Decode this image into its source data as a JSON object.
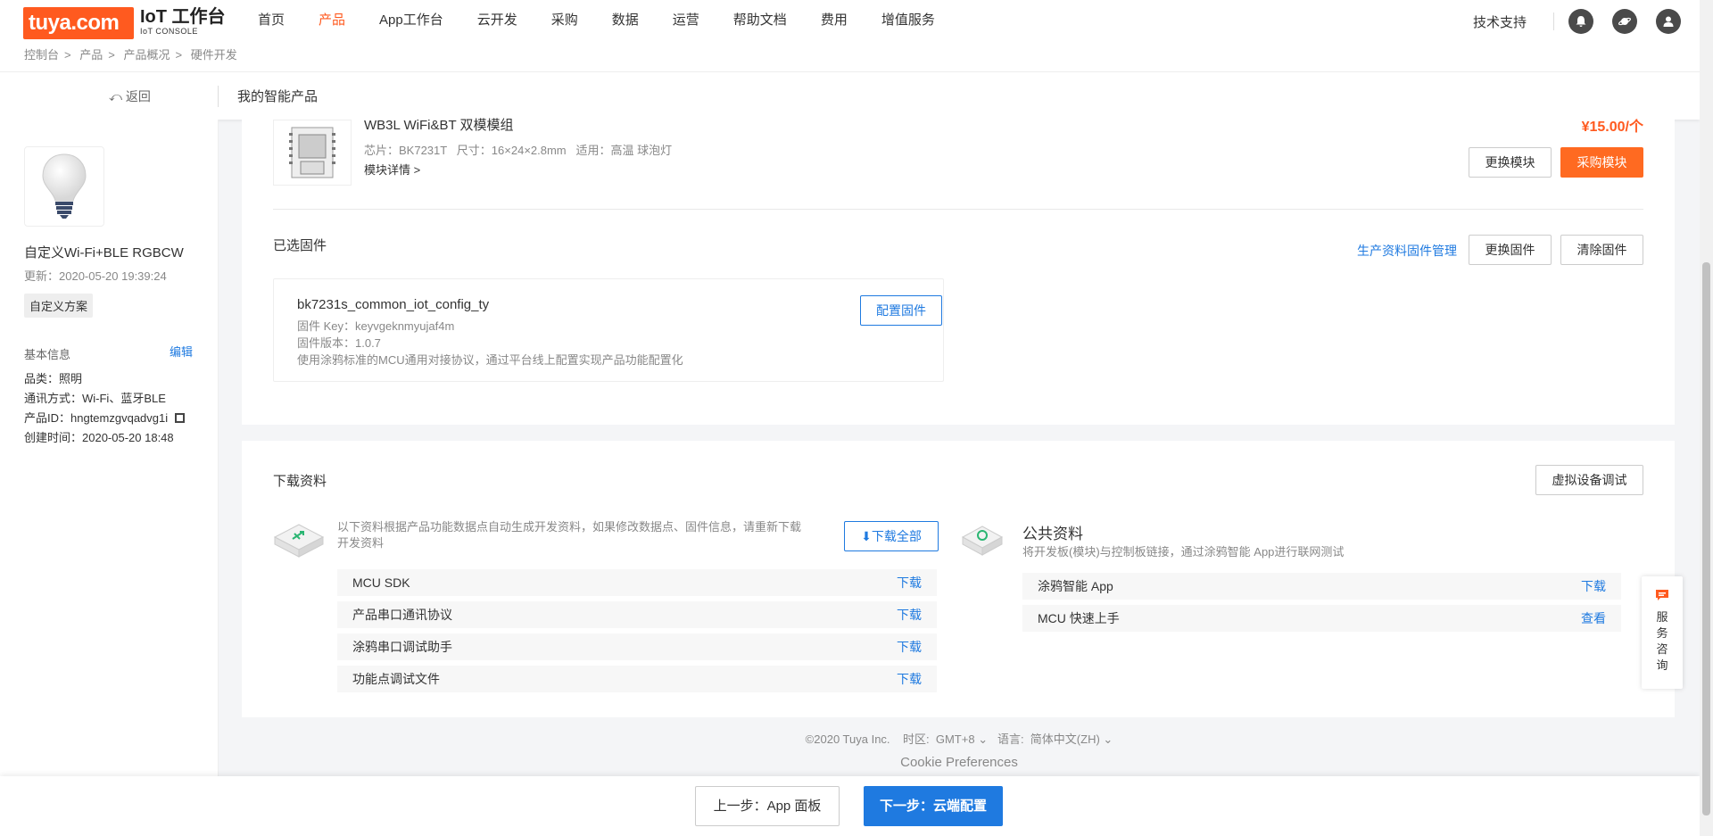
{
  "brand": {
    "logo": "tuya.com",
    "title": "IoT 工作台",
    "subtitle": "IoT CONSOLE"
  },
  "nav": {
    "items": [
      "首页",
      "产品",
      "App工作台",
      "云开发",
      "采购",
      "数据",
      "运营",
      "帮助文档",
      "费用",
      "增值服务"
    ],
    "active_index": 1,
    "support": "技术支持",
    "accent": "#ff5a1f"
  },
  "breadcrumb": [
    "控制台",
    "产品",
    "产品概况",
    "硬件开发"
  ],
  "subheader": {
    "back": "返回",
    "title": "我的智能产品"
  },
  "sidebar": {
    "product_name": "自定义Wi-Fi+BLE RGBCW",
    "updated": "更新：2020-05-20 19:39:24",
    "tag": "自定义方案",
    "basic_info": "基本信息",
    "edit": "编辑",
    "info": {
      "category": "品类：照明",
      "comm": "通讯方式：Wi-Fi、蓝牙BLE",
      "pid": "产品ID：hngtemzgvqadvg1i",
      "created": "创建时间：2020-05-20 18:48"
    }
  },
  "module": {
    "title": "WB3L WiFi&BT 双模模组",
    "spec": "芯片：BK7231T   尺寸：16×24×2.8mm   适用：高温 球泡灯",
    "detail": "模块详情 >",
    "price": "¥15.00/个",
    "replace_btn": "更换模块",
    "buy_btn": "采购模块"
  },
  "firmware": {
    "section_title": "已选固件",
    "manage_link": "生产资料固件管理",
    "replace_btn": "更换固件",
    "clear_btn": "清除固件",
    "name": "bk7231s_common_iot_config_ty",
    "key": "固件 Key：keyvgeknmyujaf4m",
    "version": "固件版本：1.0.7",
    "desc": "使用涂鸦标准的MCU通用对接协议，通过平台线上配置实现产品功能配置化",
    "config_btn": "配置固件"
  },
  "downloads": {
    "section_title": "下载资料",
    "virtual_btn": "虚拟设备调试",
    "desc": "以下资料根据产品功能数据点自动生成开发资料，如果修改数据点、固件信息，请重新下载开发资料",
    "download_all": "下载全部",
    "items": [
      {
        "name": "MCU SDK",
        "action": "下载"
      },
      {
        "name": "产品串口通讯协议",
        "action": "下载"
      },
      {
        "name": "涂鸦串口调试助手",
        "action": "下载"
      },
      {
        "name": "功能点调试文件",
        "action": "下载"
      }
    ],
    "public": {
      "title": "公共资料",
      "desc": "将开发板(模块)与控制板链接，通过涂鸦智能 App进行联网测试",
      "items": [
        {
          "name": "涂鸦智能 App",
          "action": "下载"
        },
        {
          "name": "MCU 快速上手",
          "action": "查看"
        }
      ]
    }
  },
  "footer": {
    "copyright": "©2020 Tuya Inc.",
    "timezone_label": "时区:",
    "timezone": "GMT+8",
    "lang_label": "语言:",
    "lang": "简体中文(ZH)",
    "cookie": "Cookie Preferences"
  },
  "bottom": {
    "prev": "上一步：App 面板",
    "next": "下一步：云端配置"
  },
  "service": {
    "label": "服务咨询"
  }
}
